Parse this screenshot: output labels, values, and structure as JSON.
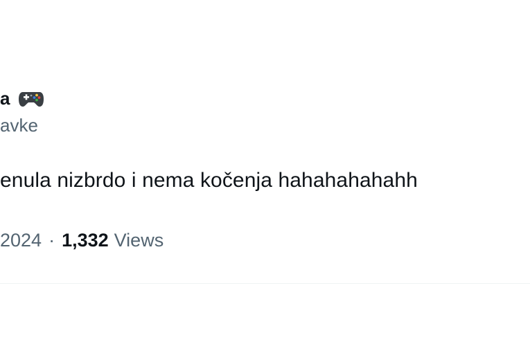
{
  "tweet": {
    "display_name": "a",
    "name_icon": "game-controller-icon",
    "handle": "avke",
    "text": "enula nizbrdo i nema kočenja hahahahahahh",
    "date": "2024",
    "separator": "·",
    "views_count": "1,332",
    "views_label": "Views"
  },
  "colors": {
    "text_primary": "#0f1419",
    "text_secondary": "#536471",
    "divider": "#eff3f4",
    "background": "#ffffff"
  }
}
